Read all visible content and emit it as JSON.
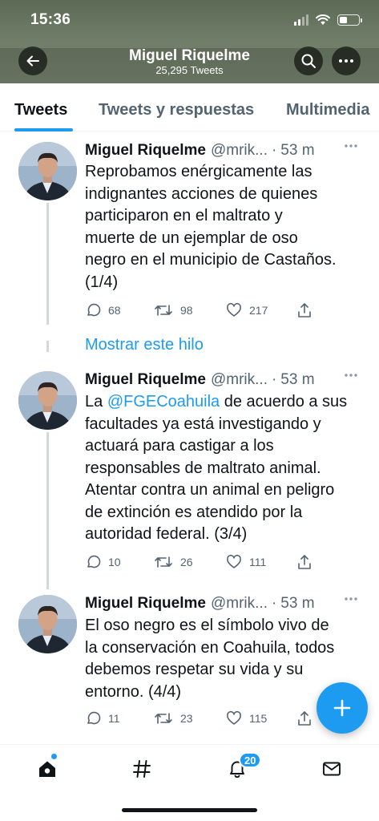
{
  "status_bar": {
    "time": "15:36"
  },
  "header": {
    "title": "Miguel Riquelme",
    "subtitle": "25,295 Tweets",
    "icons": {
      "back": "back-arrow-icon",
      "search": "search-icon",
      "more": "more-icon"
    }
  },
  "tabs": [
    {
      "label": "Tweets",
      "active": true
    },
    {
      "label": "Tweets y respuestas",
      "active": false
    },
    {
      "label": "Multimedia",
      "active": false
    }
  ],
  "tweets": [
    {
      "name": "Miguel Riquelme",
      "handle": "@mrik...",
      "dot": "·",
      "time": "53 m",
      "text_lines": [
        "Reprobamos enérgicamente las",
        "indignantes acciones de quienes",
        "participaron en el maltrato y",
        "muerte de un ejemplar de oso",
        "negro en el municipio de Castaños.",
        "(1/4)"
      ],
      "replies": "68",
      "retweets": "98",
      "likes": "217"
    },
    {
      "name": "Miguel Riquelme",
      "handle": "@mrik...",
      "dot": "·",
      "time": "53 m",
      "text_prefix": "La ",
      "mention": "@FGECoahuila",
      "text_after_mention": " de acuerdo a sus",
      "text_lines": [
        "facultades ya está investigando y",
        "actuará para castigar a los",
        "responsables de maltrato animal.",
        "Atentar contra un animal en peligro",
        "de extinción es atendido por la",
        "autoridad federal. (3/4)"
      ],
      "replies": "10",
      "retweets": "26",
      "likes": "111"
    },
    {
      "name": "Miguel Riquelme",
      "handle": "@mrik...",
      "dot": "·",
      "time": "53 m",
      "text_lines": [
        "El oso negro es el símbolo vivo de",
        "la conservación en Coahuila, todos",
        "debemos respetar su vida y su",
        "entorno. (4/4)"
      ],
      "replies": "11",
      "retweets": "23",
      "likes": "115"
    }
  ],
  "show_thread": "Mostrar este hilo",
  "bottom_nav": {
    "items": [
      "home-icon",
      "explore-hashtag-icon",
      "notifications-bell-icon",
      "messages-envelope-icon"
    ],
    "notifications_badge": "20"
  },
  "colors": {
    "accent": "#1d9bf0",
    "text": "#0f1419",
    "muted": "#536471"
  }
}
